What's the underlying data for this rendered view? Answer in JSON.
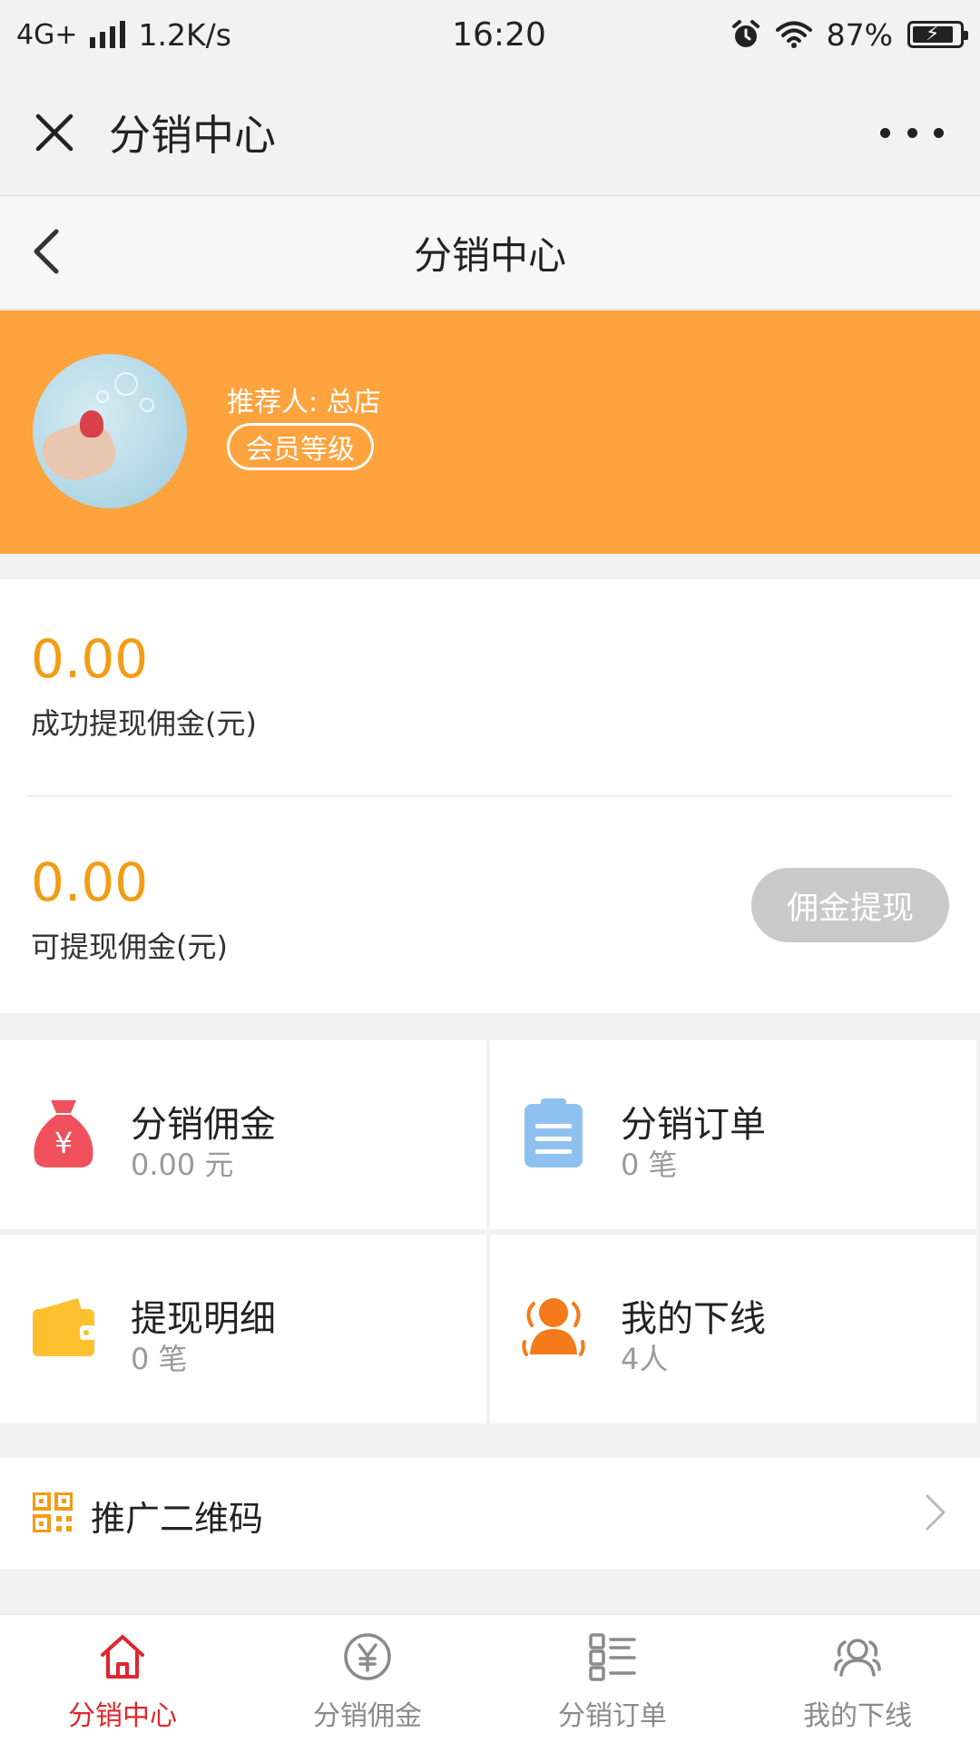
{
  "status_bar": {
    "network": "4G+",
    "speed": "1.2K/s",
    "time": "16:20",
    "battery": "87%",
    "battery_level": 0.87
  },
  "wechat_bar": {
    "title": "分销中心"
  },
  "page_header": {
    "title": "分销中心"
  },
  "profile": {
    "referrer": "推荐人: 总店",
    "level_badge": "会员等级"
  },
  "commission": {
    "success_amount": "0.00",
    "success_label": "成功提现佣金(元)",
    "available_amount": "0.00",
    "available_label": "可提现佣金(元)",
    "withdraw_button": "佣金提现"
  },
  "grid": [
    {
      "title": "分销佣金",
      "value": "0.00 元",
      "icon": "money-bag-icon",
      "color": "#f0505b"
    },
    {
      "title": "分销订单",
      "value": "0 笔",
      "icon": "clipboard-icon",
      "color": "#8fc1f0"
    },
    {
      "title": "提现明细",
      "value": "0 笔",
      "icon": "wallet-icon",
      "color": "#fdc12f"
    },
    {
      "title": "我的下线",
      "value": "4人",
      "icon": "team-icon",
      "color": "#f57a1c"
    }
  ],
  "qr": {
    "label": "推广二维码"
  },
  "tabs": [
    {
      "label": "分销中心",
      "icon": "home-icon",
      "active": true
    },
    {
      "label": "分销佣金",
      "icon": "yen-circle-icon",
      "active": false
    },
    {
      "label": "分销订单",
      "icon": "list-icon",
      "active": false
    },
    {
      "label": "我的下线",
      "icon": "users-icon",
      "active": false
    }
  ],
  "colors": {
    "accent_orange": "#fea33e",
    "amount_orange": "#f39c12",
    "tab_active": "#e0262c",
    "tab_inactive": "#8a8a8a"
  }
}
